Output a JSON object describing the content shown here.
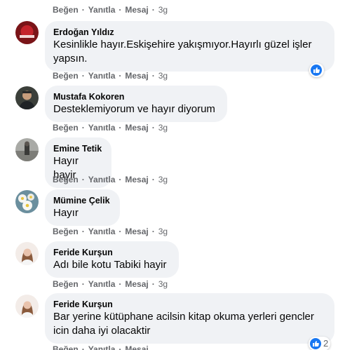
{
  "actions": {
    "like": "Beğen",
    "reply": "Yanıtla",
    "message": "Mesaj",
    "sep": "·"
  },
  "top_row": {
    "time": "3g"
  },
  "comments": [
    {
      "name": "Erdoğan Yıldız",
      "text": "Kesinlikle hayır.Eskişehire yakışmıyor.Hayırlı güzel işler yapsın.",
      "time": "3g",
      "reaction_icon": "like-icon"
    },
    {
      "name": "Mustafa Kokoren",
      "text": "Desteklemiyorum ve hayır diyorum",
      "time": "3g"
    },
    {
      "name": "Emine Tetik",
      "text": "Hayır hayir",
      "time": "3g"
    },
    {
      "name": "Mümine Çelik",
      "text": "Hayır",
      "time": "3g"
    },
    {
      "name": "Feride Kurşun",
      "text": "Adı bile kotu Tabiki hayir",
      "time": "3g"
    },
    {
      "name": "Feride Kurşun",
      "text": "Bar yerine kütüphane acilsin kitap okuma yerleri gencler icin daha iyi olacaktir",
      "reaction_icon": "like-icon",
      "reaction_count": "2"
    }
  ],
  "colors": {
    "bubble": "#f0f2f5",
    "secondary_text": "#65676b",
    "like_blue": "#1877f2"
  }
}
